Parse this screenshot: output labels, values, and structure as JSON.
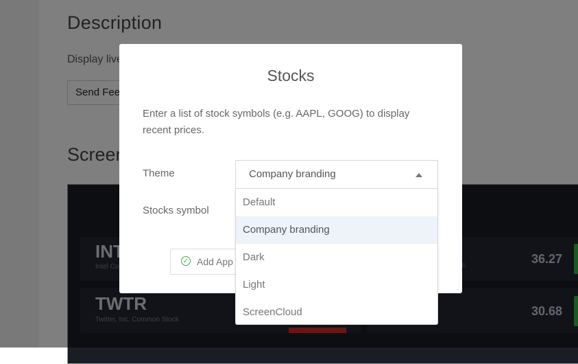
{
  "background": {
    "description_title": "Description",
    "description_text": "Display live stock prices",
    "feedback_button": "Send Feedback",
    "screens_title": "Screenshots",
    "preview": {
      "stocks": [
        {
          "symbol": "INTC",
          "name": "Intel Corporation",
          "price": ""
        },
        {
          "symbol": "TWTR",
          "name": "Twitter, Inc. Common Stock",
          "price": ""
        }
      ],
      "right_stocks": [
        {
          "name": "Inc.",
          "price": "36.27"
        },
        {
          "name": "",
          "price": "30.68"
        }
      ]
    }
  },
  "modal": {
    "title": "Stocks",
    "description": "Enter a list of stock symbols (e.g. AAPL, GOOG) to display recent prices.",
    "theme_label": "Theme",
    "symbol_label": "Stocks symbol",
    "add_app_label": "Add App",
    "theme_select": {
      "value": "Company branding",
      "options": [
        "Default",
        "Company branding",
        "Dark",
        "Light",
        "ScreenCloud"
      ],
      "selected_index": 1
    }
  },
  "colors": {
    "accent_green": "#3db04a",
    "down_red": "#d22c2c",
    "overlay": "rgba(0,0,0,0.5)"
  }
}
